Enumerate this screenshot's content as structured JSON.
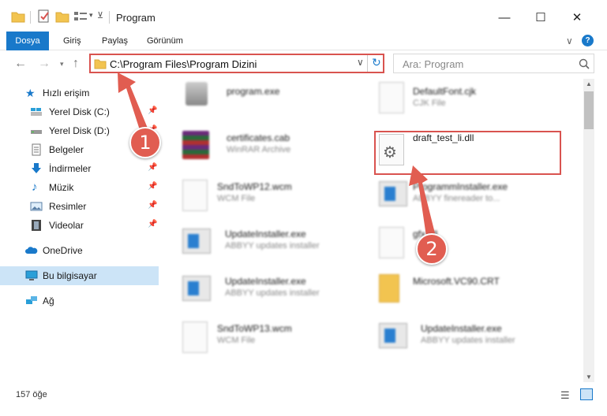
{
  "window": {
    "title": "Program",
    "minimize": "—",
    "maximize": "☐",
    "close": "✕"
  },
  "ribbon": {
    "tabs": [
      "Dosya",
      "Giriş",
      "Paylaş",
      "Görünüm"
    ],
    "help": "?",
    "expand": "∨"
  },
  "address": {
    "path": "C:\\Program Files\\Program Dizini",
    "search_placeholder": "Ara: Program"
  },
  "nav": {
    "quick_access": "Hızlı erişim",
    "items": [
      "Yerel Disk (C:)",
      "Yerel Disk (D:)",
      "Belgeler",
      "İndirmeler",
      "Müzik",
      "Resimler",
      "Videolar"
    ],
    "onedrive": "OneDrive",
    "this_pc": "Bu bilgisayar",
    "network": "Ağ"
  },
  "files": [
    {
      "name": "program.exe",
      "type": ""
    },
    {
      "name": "DefaultFont.cjk",
      "type": "CJK File"
    },
    {
      "name": "certificates.cab",
      "type": "WinRAR Archive"
    },
    {
      "name": "draft_test_li.dll",
      "type": ""
    },
    {
      "name": "SndToWP12.wcm",
      "type": "WCM File"
    },
    {
      "name": "ProgrammInstaller.exe",
      "type": "ABBYY finereader to..."
    },
    {
      "name": "UpdateInstaller.exe",
      "type": "ABBYY updates installer"
    },
    {
      "name": "gfx.dll",
      "type": ""
    },
    {
      "name": "UpdateInstaller.exe",
      "type": "ABBYY updates installer"
    },
    {
      "name": "Microsoft.VC90.CRT",
      "type": ""
    },
    {
      "name": "SndToWP13.wcm",
      "type": "WCM File"
    },
    {
      "name": "UpdateInstaller.exe",
      "type": "ABBYY updates installer"
    }
  ],
  "status": {
    "count": "157 öğe"
  },
  "annotations": {
    "step1": "1",
    "step2": "2",
    "color": "#e15d51"
  }
}
